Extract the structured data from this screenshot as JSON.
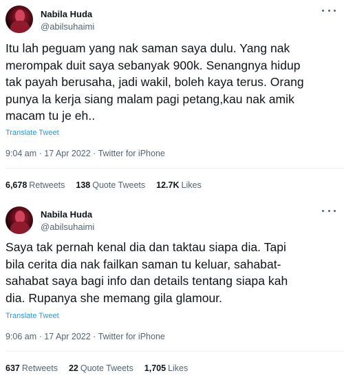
{
  "tweets": [
    {
      "author_name": "Nabila Huda",
      "author_handle": "@abilsuhaimi",
      "text": "Itu lah peguam yang nak saman saya dulu. Yang nak\nmerompak duit saya sebanyak 900k. Senangnya hidup\ntak payah berusaha, jadi wakil, boleh kaya terus. Orang\npunya la kerja siang malam pagi petang,kau nak amik\nmacam tu je eh..",
      "translate_label": "Translate Tweet",
      "time": "9:04 am · 17 Apr 2022 · Twitter for iPhone",
      "stats": {
        "retweets_count": "6,678",
        "retweets_label": "Retweets",
        "quotes_count": "138",
        "quotes_label": "Quote Tweets",
        "likes_count": "12.7K",
        "likes_label": "Likes"
      }
    },
    {
      "author_name": "Nabila Huda",
      "author_handle": "@abilsuhaimi",
      "text": "Saya tak pernah kenal dia dan taktau siapa dia. Tapi\nbila cerita dia nak failkan saman tu keluar, sahabat-\nsahabat saya bagi info dan details tentang siapa kah\ndia. Rupanya she memang gila glamour.",
      "translate_label": "Translate Tweet",
      "time": "9:06 am · 17 Apr 2022 · Twitter for iPhone",
      "stats": {
        "retweets_count": "637",
        "retweets_label": "Retweets",
        "quotes_count": "22",
        "quotes_label": "Quote Tweets",
        "likes_count": "1,705",
        "likes_label": "Likes"
      }
    }
  ],
  "icons": {
    "more": "more-icon",
    "avatar": "avatar"
  },
  "colors": {
    "link": "#1d9bf0",
    "secondary_text": "#536471",
    "primary_text": "#0f1419"
  }
}
